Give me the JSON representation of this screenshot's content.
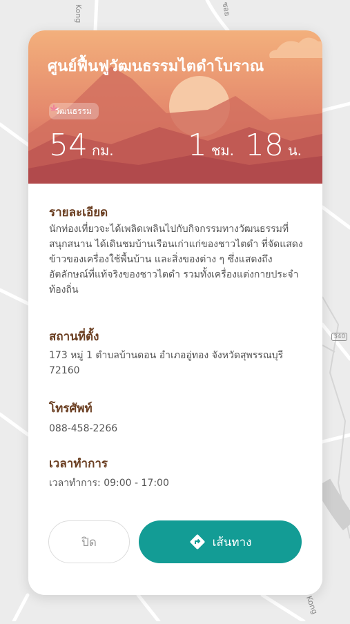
{
  "map": {
    "labels": [
      "Kong",
      "ซอย",
      "340",
      "Kong"
    ]
  },
  "card": {
    "title": "ศูนย์ฟื้นฟูวัฒนธรรมไตดำโบราณ",
    "category": "วัฒนธรรม",
    "distance": {
      "value": "54",
      "unit": "กม."
    },
    "duration": {
      "hours": "1",
      "hours_unit": "ชม.",
      "minutes": "18",
      "minutes_unit": "น."
    },
    "sections": {
      "details": {
        "title": "รายละเอียด",
        "lines": [
          "นักท่องเที่ยวจะได้เพลิดเพลินไปกับกิจกรรมทางวัฒนธรรมที่",
          "สนุกสนาน ได้เดินชมบ้านเรือนเก่าแก่ของชาวไตดำ ที่จัดแสดง",
          "ข้าวของเครื่องใช้พื้นบ้าน และสิ่งของต่าง ๆ ซึ่งแสดงถึง",
          "อัตลักษณ์ที่แท้จริงของชาวไตดำ รวมทั้งเครื่องแต่งกายประจำ",
          "ท้องถิ่น"
        ]
      },
      "location": {
        "title": "สถานที่ตั้ง",
        "lines": [
          "173 หมู่ 1 ตำบลบ้านดอน อำเภออู่ทอง จังหวัดสุพรรณบุรี",
          "72160"
        ]
      },
      "phone": {
        "title": "โทรศัพท์",
        "value": "088-458-2266"
      },
      "hours": {
        "title": "เวลาทำการ",
        "value": "เวลาทำการ: 09:00 - 17:00"
      }
    },
    "buttons": {
      "close": "ปิด",
      "route": "เส้นทาง"
    }
  },
  "colors": {
    "accent": "#139c95",
    "heading": "#6b3f22",
    "hero_top": "#f3b07c",
    "hero_bottom": "#b9464b"
  },
  "icons": {
    "badge": "lotus-icon",
    "route": "directions-icon"
  }
}
